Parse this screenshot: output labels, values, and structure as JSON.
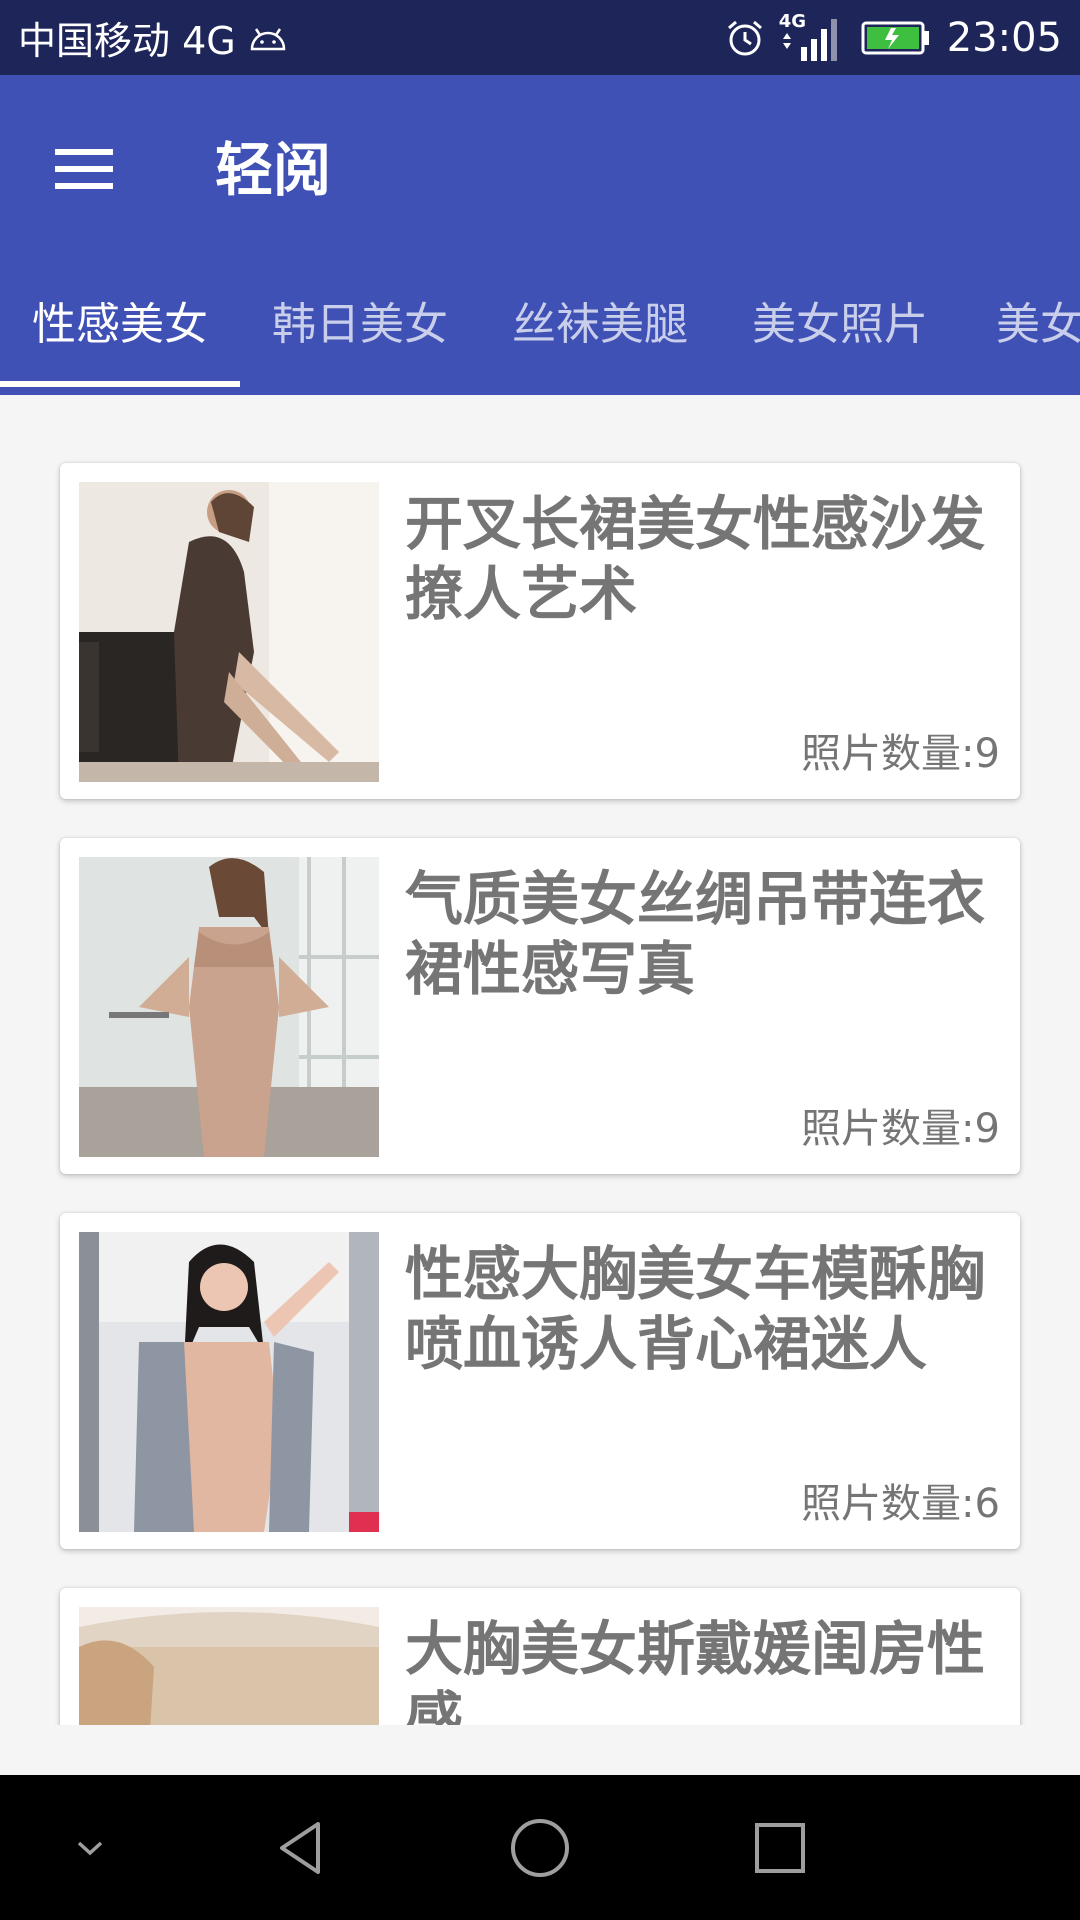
{
  "status_bar": {
    "carrier": "中国移动 4G",
    "network": "4G",
    "time": "23:05"
  },
  "app_bar": {
    "title": "轻阅"
  },
  "tabs": [
    {
      "label": "性感美女",
      "active": true
    },
    {
      "label": "韩日美女",
      "active": false
    },
    {
      "label": "丝袜美腿",
      "active": false
    },
    {
      "label": "美女照片",
      "active": false
    },
    {
      "label": "美女",
      "active": false
    }
  ],
  "albums": [
    {
      "title": "开叉长裙美女性感沙发撩人艺术",
      "count": "照片数量:9"
    },
    {
      "title": "气质美女丝绸吊带连衣裙性感写真",
      "count": "照片数量:9"
    },
    {
      "title": "性感大胸美女车模酥胸喷血诱人背心裙迷人",
      "count": "照片数量:6"
    },
    {
      "title": "大胸美女斯戴媛闺房性感",
      "count": ""
    }
  ],
  "colors": {
    "status_bar": "#1e2559",
    "primary": "#3f51b5",
    "background": "#f5f5f5",
    "card_text": "#757575"
  },
  "icons": {
    "menu": "hamburger-menu",
    "back": "back-triangle",
    "home": "home-circle",
    "recents": "recents-square",
    "collapse": "chevron-down"
  }
}
